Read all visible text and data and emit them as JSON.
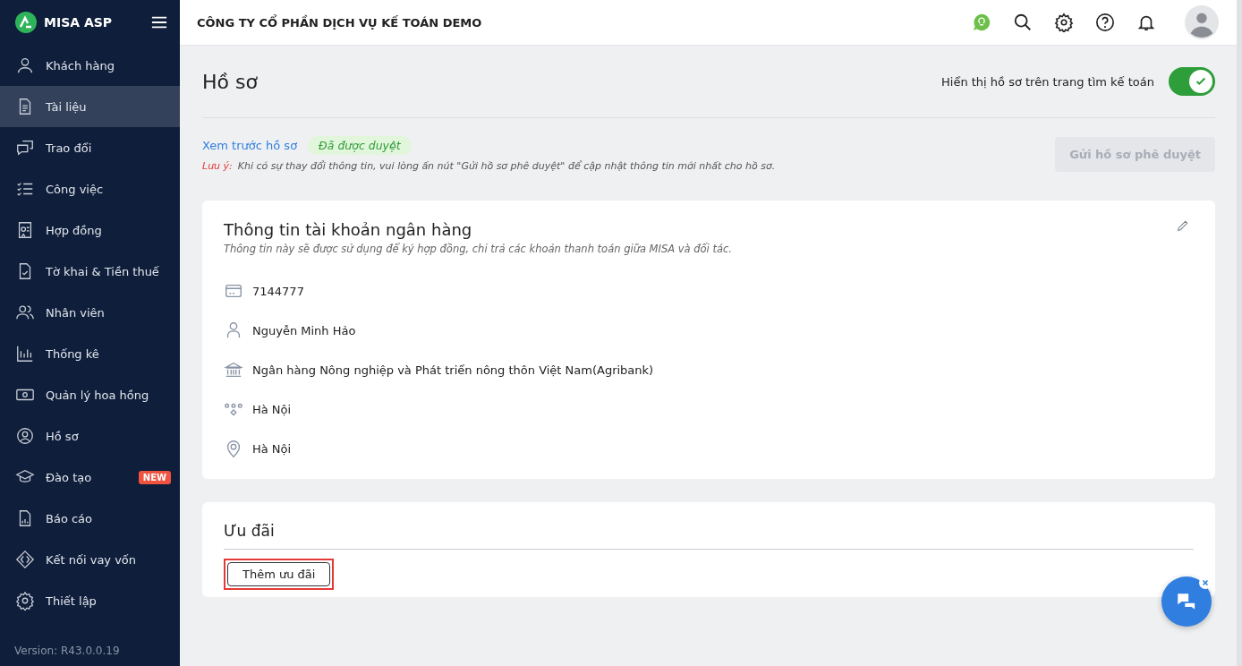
{
  "brand": {
    "name": "MISA ASP"
  },
  "sidebar": {
    "items": [
      {
        "label": "Khách hàng",
        "selected": false
      },
      {
        "label": "Tài liệu",
        "selected": true
      },
      {
        "label": "Trao đổi",
        "selected": false
      },
      {
        "label": "Công việc",
        "selected": false
      },
      {
        "label": "Hợp đồng",
        "selected": false
      },
      {
        "label": "Tờ khai & Tiền thuế",
        "selected": false
      },
      {
        "label": "Nhân viên",
        "selected": false
      },
      {
        "label": "Thống kê",
        "selected": false
      },
      {
        "label": "Quản lý hoa hồng",
        "selected": false
      },
      {
        "label": "Hồ sơ",
        "selected": false
      },
      {
        "label": "Đào tạo",
        "selected": false,
        "badge": "NEW"
      },
      {
        "label": "Báo cáo",
        "selected": false
      },
      {
        "label": "Kết nối vay vốn",
        "selected": false
      },
      {
        "label": "Thiết lập",
        "selected": false
      }
    ],
    "version": "Version: R43.0.0.19"
  },
  "header": {
    "company": "CÔNG TY CỔ PHẦN DỊCH VỤ KẾ TOÁN DEMO"
  },
  "page": {
    "title": "Hồ sơ",
    "toggle": {
      "label": "Hiển thị hồ sơ trên trang tìm kế toán",
      "on": true
    },
    "preview_link": "Xem trước hồ sơ",
    "status": "Đã được duyệt",
    "note_label": "Lưu ý:",
    "note": "Khi có sự thay đổi thông tin, vui lòng ấn nút \"Gửi hồ sơ phê duyệt\" để cập nhật thông tin mới nhất cho hồ sơ.",
    "submit_button": {
      "label": "Gửi hồ sơ phê duyệt",
      "disabled": true
    }
  },
  "bank_card": {
    "title": "Thông tin tài khoản ngân hàng",
    "subtitle": "Thông tin này sẽ được sử dụng để ký hợp đồng, chi trả các khoản thanh toán giữa MISA và đối tác.",
    "rows": [
      {
        "kind": "account",
        "value": "7144777"
      },
      {
        "kind": "holder",
        "value": "Nguyễn Minh Hảo"
      },
      {
        "kind": "bank",
        "value": "Ngân hàng Nông nghiệp và Phát triển nông thôn Việt Nam(Agribank)"
      },
      {
        "kind": "branch",
        "value": "Hà Nội"
      },
      {
        "kind": "location",
        "value": "Hà Nội"
      }
    ]
  },
  "offers_card": {
    "title": "Ưu đãi",
    "add_button": {
      "label": "Thêm ưu đãi",
      "highlighted": true
    }
  }
}
